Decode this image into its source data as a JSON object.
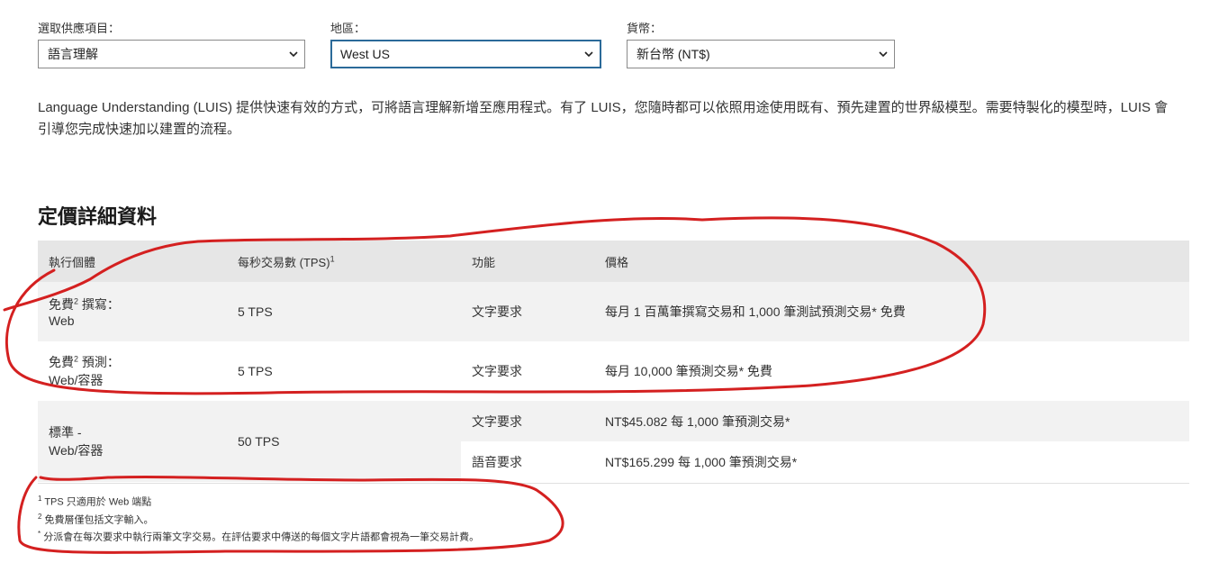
{
  "selectors": {
    "product": {
      "label": "選取供應項目：",
      "value": "語言理解"
    },
    "region": {
      "label": "地區：",
      "value": "West US"
    },
    "currency": {
      "label": "貨幣：",
      "value": "新台幣 (NT$)"
    }
  },
  "description": "Language Understanding (LUIS) 提供快速有效的方式，可將語言理解新增至應用程式。有了 LUIS，您隨時都可以依照用途使用既有、預先建置的世界級模型。需要特製化的模型時，LUIS 會引導您完成快速加以建置的流程。",
  "pricing": {
    "title": "定價詳細資料",
    "headers": {
      "instance": "執行個體",
      "tps": "每秒交易數 (TPS)",
      "tps_sup": "1",
      "feature": "功能",
      "price": "價格"
    },
    "rows": [
      {
        "instance_prefix": "免費",
        "instance_sup": "2",
        "instance_suffix": " 撰寫：",
        "instance_line2": "Web",
        "tps": "5 TPS",
        "feature": "文字要求",
        "price": "每月 1 百萬筆撰寫交易和 1,000 筆測試預測交易* 免費"
      },
      {
        "instance_prefix": "免費",
        "instance_sup": "2",
        "instance_suffix": " 預測：",
        "instance_line2": "Web/容器",
        "tps": "5 TPS",
        "feature": "文字要求",
        "price": "每月 10,000 筆預測交易* 免費"
      },
      {
        "instance_line1": "標準 -",
        "instance_line2": "Web/容器",
        "tps": "50 TPS",
        "sub": [
          {
            "feature": "文字要求",
            "price": "NT$45.082 每 1,000 筆預測交易*"
          },
          {
            "feature": "語音要求",
            "price": "NT$165.299 每 1,000 筆預測交易*"
          }
        ]
      }
    ]
  },
  "footnotes": [
    {
      "mark": "1",
      "text": "TPS 只適用於 Web 端點"
    },
    {
      "mark": "2",
      "text": "免費層僅包括文字輸入。"
    },
    {
      "mark": "*",
      "text": "分派會在每次要求中執行兩筆文字交易。在評估要求中傳送的每個文字片語都會視為一筆交易計費。"
    }
  ],
  "colors": {
    "annotation": "#d42020",
    "focus_border": "#2b6a99",
    "header_bg": "#e6e6e6",
    "stripe_bg": "#f2f2f2"
  }
}
